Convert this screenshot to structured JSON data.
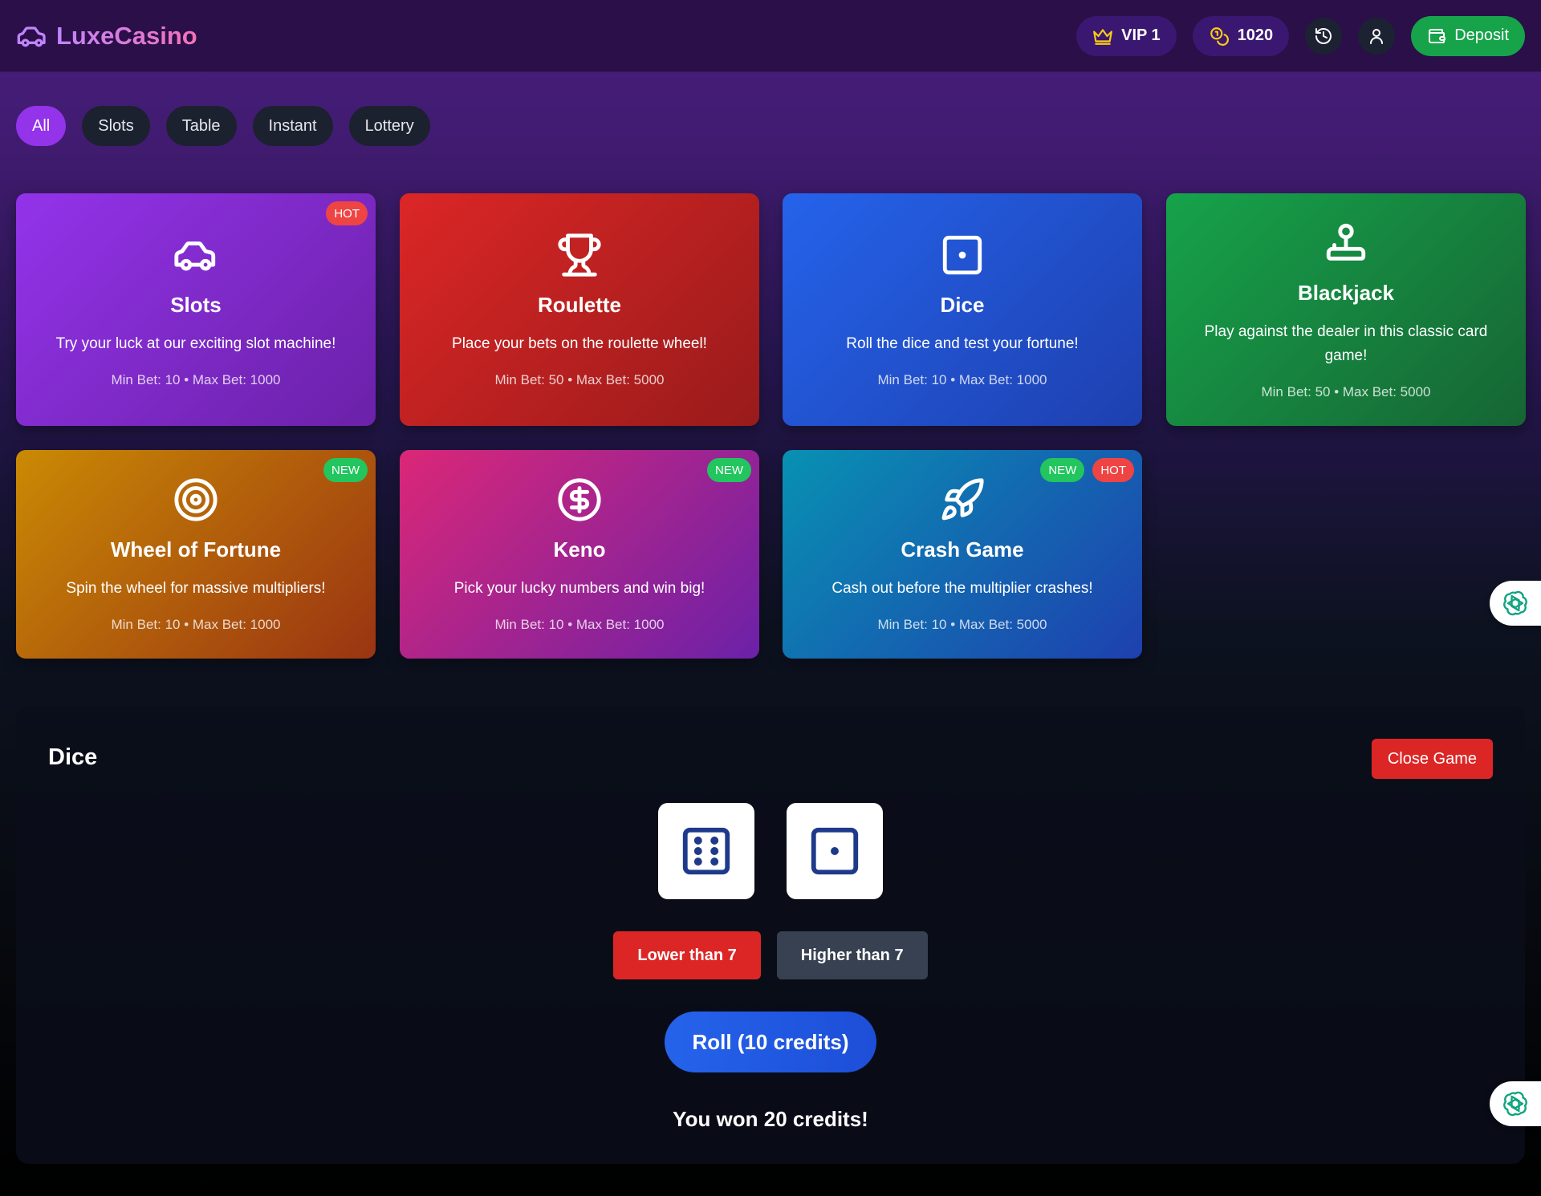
{
  "header": {
    "brand": "LuxeCasino",
    "vip_label": "VIP 1",
    "balance": "1020",
    "deposit_label": "Deposit"
  },
  "filters": [
    "All",
    "Slots",
    "Table",
    "Instant",
    "Lottery"
  ],
  "games": [
    {
      "title": "Slots",
      "desc": "Try your luck at our exciting slot machine!",
      "meta": "Min Bet: 10 • Max Bet: 1000",
      "badges": [
        "HOT"
      ],
      "icon": "car-icon",
      "colors": [
        "#9333ea",
        "#6b21a8"
      ]
    },
    {
      "title": "Roulette",
      "desc": "Place your bets on the roulette wheel!",
      "meta": "Min Bet: 50 • Max Bet: 5000",
      "badges": [],
      "icon": "trophy-icon",
      "colors": [
        "#dc2626",
        "#991b1b"
      ]
    },
    {
      "title": "Dice",
      "desc": "Roll the dice and test your fortune!",
      "meta": "Min Bet: 10 • Max Bet: 1000",
      "badges": [],
      "icon": "die-icon",
      "colors": [
        "#2563eb",
        "#1e40af"
      ]
    },
    {
      "title": "Blackjack",
      "desc": "Play against the dealer in this classic card game!",
      "meta": "Min Bet: 50 • Max Bet: 5000",
      "badges": [],
      "icon": "joystick-icon",
      "colors": [
        "#16a34a",
        "#166534"
      ]
    },
    {
      "title": "Wheel of Fortune",
      "desc": "Spin the wheel for massive multipliers!",
      "meta": "Min Bet: 10 • Max Bet: 1000",
      "badges": [
        "NEW"
      ],
      "icon": "target-icon",
      "colors": [
        "#ca8a04",
        "#9a3412"
      ]
    },
    {
      "title": "Keno",
      "desc": "Pick your lucky numbers and win big!",
      "meta": "Min Bet: 10 • Max Bet: 1000",
      "badges": [
        "NEW"
      ],
      "icon": "dollar-circle-icon",
      "colors": [
        "#db2777",
        "#6b21a8"
      ]
    },
    {
      "title": "Crash Game",
      "desc": "Cash out before the multiplier crashes!",
      "meta": "Min Bet: 10 • Max Bet: 5000",
      "badges": [
        "NEW",
        "HOT"
      ],
      "icon": "rocket-icon",
      "colors": [
        "#0891b2",
        "#1e40af"
      ]
    }
  ],
  "panel": {
    "title": "Dice",
    "close_label": "Close Game",
    "dice_values": [
      6,
      1
    ],
    "lower_label": "Lower than 7",
    "higher_label": "Higher than 7",
    "roll_label": "Roll (10 credits)",
    "result": "You won 20 credits!"
  }
}
